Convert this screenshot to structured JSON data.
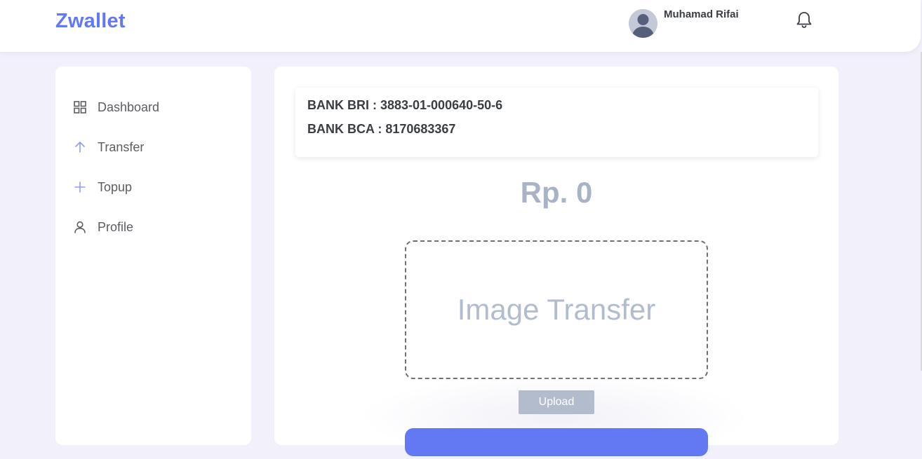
{
  "header": {
    "brand": "Zwallet",
    "user_name": "Muhamad Rifai"
  },
  "sidebar": {
    "items": [
      {
        "label": "Dashboard",
        "icon": "grid-icon"
      },
      {
        "label": "Transfer",
        "icon": "arrow-up-icon"
      },
      {
        "label": "Topup",
        "icon": "plus-icon"
      },
      {
        "label": "Profile",
        "icon": "user-icon"
      }
    ]
  },
  "main": {
    "banks": [
      "BANK BRI : 3883-01-000640-50-6",
      "BANK BCA : 8170683367"
    ],
    "amount": "Rp. 0",
    "dropzone_label": "Image Transfer",
    "upload_label": "Upload"
  },
  "colors": {
    "brand": "#6379f4",
    "background": "#f2f0fb",
    "muted": "#b3bccd"
  }
}
